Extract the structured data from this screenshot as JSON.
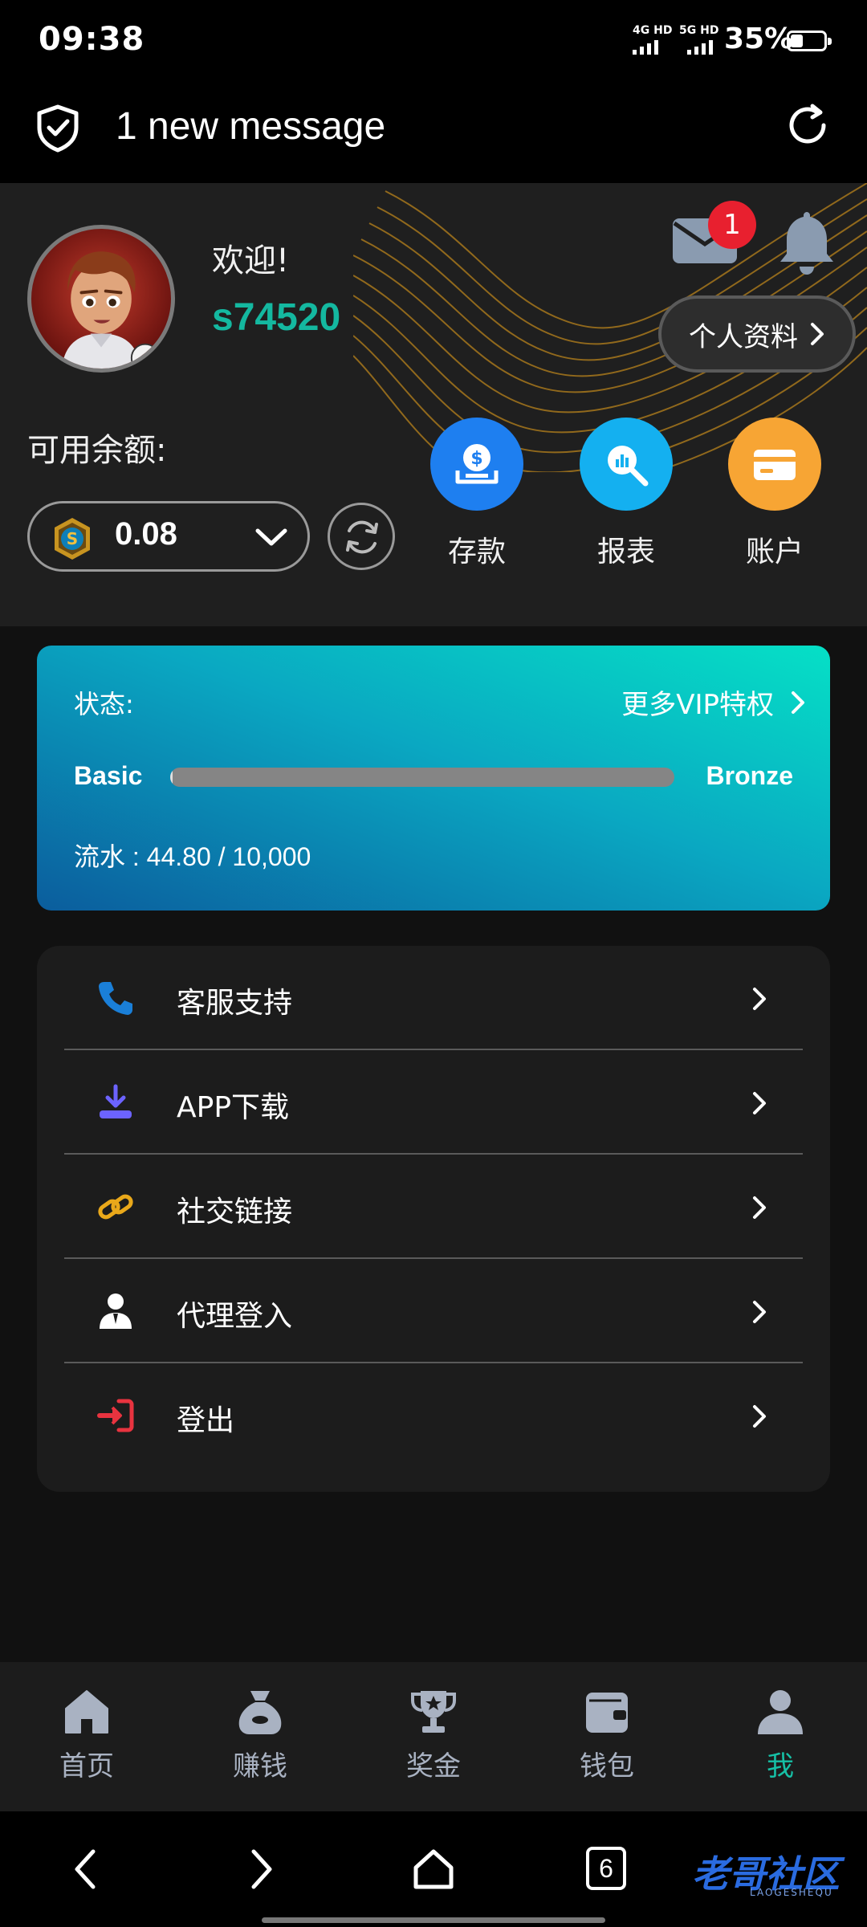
{
  "status_bar": {
    "time": "09:38",
    "network1": "4G HD",
    "network2": "5G HD",
    "battery_text": "35%",
    "battery_level": 0.35
  },
  "notification": {
    "text": "1 new message"
  },
  "profile": {
    "welcome": "欢迎!",
    "username": "s74520",
    "mail_badge": "1",
    "profile_button": "个人资料",
    "balance_label": "可用余额:",
    "balance_value": "0.08"
  },
  "actions": [
    {
      "label": "存款",
      "color": "#1e7ff0",
      "icon": "deposit-icon"
    },
    {
      "label": "报表",
      "color": "#14b0f0",
      "icon": "report-icon"
    },
    {
      "label": "账户",
      "color": "#f7a534",
      "icon": "account-card-icon"
    }
  ],
  "vip": {
    "status_label": "状态:",
    "more_label": "更多VIP特权",
    "current_level": "Basic",
    "next_level": "Bronze",
    "progress": 0.00448,
    "turnover": "流水 : 44.80 / 10,000"
  },
  "menu": [
    {
      "label": "客服支持",
      "icon": "phone-icon",
      "color": "#1a7fd8"
    },
    {
      "label": "APP下载",
      "icon": "download-icon",
      "color": "#6c63ff"
    },
    {
      "label": "社交链接",
      "icon": "link-icon",
      "color": "#e9a81a"
    },
    {
      "label": "代理登入",
      "icon": "agent-icon",
      "color": "#ffffff"
    },
    {
      "label": "登出",
      "icon": "logout-icon",
      "color": "#e8333f"
    }
  ],
  "bottom_nav": [
    {
      "label": "首页",
      "icon": "home-icon",
      "active": false
    },
    {
      "label": "赚钱",
      "icon": "money-bag-icon",
      "active": false
    },
    {
      "label": "奖金",
      "icon": "trophy-icon",
      "active": false
    },
    {
      "label": "钱包",
      "icon": "wallet-icon",
      "active": false
    },
    {
      "label": "我",
      "icon": "user-icon",
      "active": true
    }
  ],
  "system_nav": {
    "tab_count": "6",
    "watermark": "老哥社区",
    "watermark_sub": "LAOGESHEQU"
  },
  "colors": {
    "accent": "#16c0a6",
    "background": "#111111",
    "badge": "#e8202f"
  }
}
